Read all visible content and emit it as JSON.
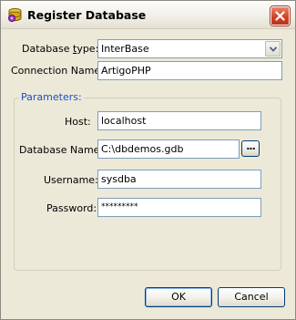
{
  "window": {
    "title": "Register Database"
  },
  "form": {
    "database_type_label": "Database type:",
    "database_type_value": "InterBase",
    "connection_name_label": "Connection Name:",
    "connection_name_value": "ArtigoPHP"
  },
  "parameters": {
    "group_title": "Parameters:",
    "host_label": "Host:",
    "host_value": "localhost",
    "database_name_label": "Database Name:",
    "database_name_value": "C:\\dbdemos.gdb",
    "browse_label": "...",
    "username_label": "Username:",
    "username_value": "sysdba",
    "password_label": "Password:",
    "password_value": "*********"
  },
  "buttons": {
    "ok_label": "OK",
    "cancel_label": "Cancel"
  },
  "icons": {
    "app": "database-register-icon",
    "close": "close-icon",
    "dropdown": "chevron-down-icon"
  },
  "colors": {
    "window_bg": "#ece9d8",
    "group_title": "#1a4ec8",
    "close_button": "#d0442a",
    "field_border": "#7f9db9"
  }
}
